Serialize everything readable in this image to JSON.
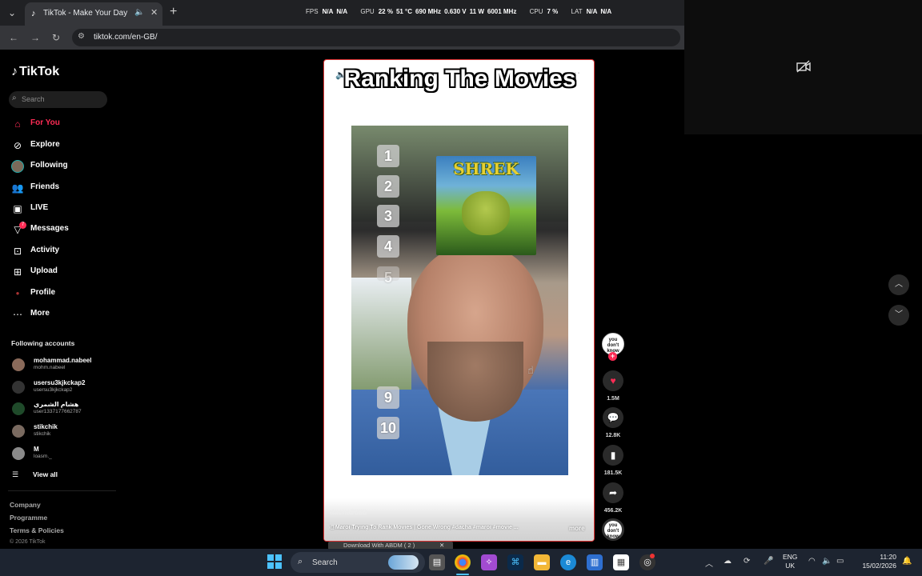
{
  "browser": {
    "tab_title": "TikTok - Make Your Day",
    "url": "tiktok.com/en-GB/"
  },
  "stats_overlay": {
    "fps_label": "FPS",
    "fps_1": "N/A",
    "fps_2": "N/A",
    "gpu_label": "GPU",
    "gpu_load": "22 %",
    "gpu_temp": "51 °C",
    "gpu_clock": "690 MHz",
    "gpu_volt": "0.630 V",
    "gpu_power": "11 W",
    "gpu_mem": "6001 MHz",
    "cpu_label": "CPU",
    "cpu_load": "7 %",
    "lat_label": "LAT",
    "lat_1": "N/A",
    "lat_2": "N/A"
  },
  "sidebar": {
    "logo": "TikTok",
    "search_placeholder": "Search",
    "nav": [
      {
        "label": "For You",
        "icon": "home-icon"
      },
      {
        "label": "Explore",
        "icon": "compass-icon"
      },
      {
        "label": "Following",
        "icon": "following-avatar-icon"
      },
      {
        "label": "Friends",
        "icon": "friends-icon"
      },
      {
        "label": "LIVE",
        "icon": "live-icon"
      },
      {
        "label": "Messages",
        "icon": "messages-icon",
        "badge": "7"
      },
      {
        "label": "Activity",
        "icon": "activity-icon"
      },
      {
        "label": "Upload",
        "icon": "upload-icon"
      },
      {
        "label": "Profile",
        "icon": "profile-icon"
      },
      {
        "label": "More",
        "icon": "more-icon"
      }
    ],
    "following_heading": "Following accounts",
    "accounts": [
      {
        "name": "mohammad.nabeel",
        "handle": "mohm.nabeel"
      },
      {
        "name": "usersu3kjkckap2",
        "handle": "usersu3kjkckap2"
      },
      {
        "name": "هشام الشمري",
        "handle": "user1337177662787"
      },
      {
        "name": "stikchik",
        "handle": "stikchik"
      },
      {
        "name": "M",
        "handle": "loasm._"
      }
    ],
    "view_all": "View all",
    "footer": [
      "Company",
      "Programme",
      "Terms & Policies"
    ],
    "copyright": "© 2026 TikTok"
  },
  "video": {
    "title": "Ranking The Movies",
    "ranks": [
      "1",
      "2",
      "3",
      "4",
      "5",
      "9",
      "10"
    ],
    "poster_title": "SHREK",
    "author": "dacha9666",
    "caption": "@Maroi Trying To Rank Movies | Gone Wrong #dacha #maroi #movie ...",
    "more": "more"
  },
  "actions": {
    "creator_avatar_text": "you don't know",
    "likes": "1.5M",
    "comments": "12.8K",
    "saves": "181.5K",
    "shares": "456.2K",
    "disc_text": "you don't know"
  },
  "download_bar": {
    "label": "Download With ABDM ( 2 )"
  },
  "taskbar": {
    "search_label": "Search",
    "lang_1": "ENG",
    "lang_2": "UK",
    "time": "11:20",
    "date": "15/02/2026"
  },
  "colors": {
    "accent": "#fe2c55",
    "browser_bg": "#202124"
  }
}
